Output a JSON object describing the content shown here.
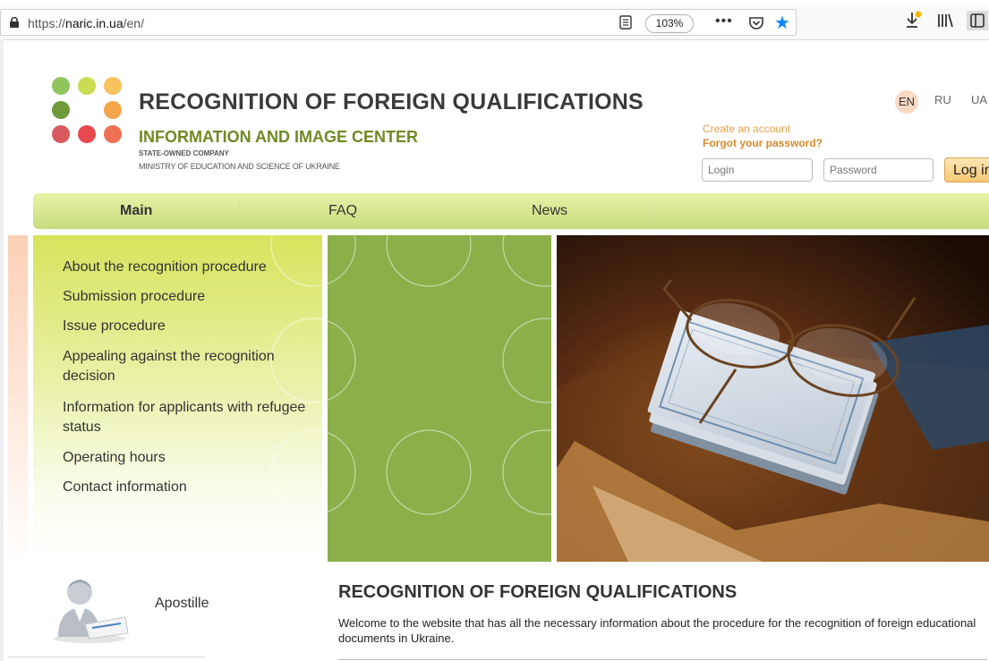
{
  "browser": {
    "url_prefix": "https://",
    "url_domain": "naric.in.ua",
    "url_path": "/en/",
    "zoom": "103%",
    "more_label": "•••",
    "bookmark_star": "★",
    "icons": [
      "lock-icon",
      "reader-view-icon",
      "pocket-icon",
      "bookmark-star-icon",
      "download-icon",
      "library-icon",
      "sidebar-icon"
    ]
  },
  "header": {
    "title": "RECOGNITION OF FOREIGN QUALIFICATIONS",
    "subtitle": "INFORMATION AND IMAGE CENTER",
    "company": "STATE-OWNED COMPANY",
    "ministry": "MINISTRY OF EDUCATION AND SCIENCE OF UKRAINE",
    "logo_colors": [
      "#8fc55e",
      "#c9dc52",
      "#f8c25c",
      "#6f9a3a",
      "#f4a54a",
      "#d9585e",
      "#e8494f",
      "#f07054"
    ]
  },
  "languages": {
    "en": "EN",
    "ru": "RU",
    "ua": "UA"
  },
  "auth": {
    "create_account": "Create an account",
    "forgot_password": "Forgot your password?",
    "login_placeholder": "Login",
    "password_placeholder": "Password",
    "login_button": "Log in"
  },
  "nav": {
    "main": "Main",
    "faq": "FAQ",
    "news": "News"
  },
  "sidebar_menu": [
    "About the recognition procedure",
    "Submission procedure",
    "Issue procedure",
    "Appealing against the recognition decision",
    "Information for applicants with refugee status",
    "Operating hours",
    "Contact information"
  ],
  "apostille": {
    "label": "Apostille"
  },
  "content": {
    "title": "RECOGNITION OF FOREIGN QUALIFICATIONS",
    "text": "Welcome to the website that has all the necessary information about the procedure for the recognition of foreign educational documents in Ukraine."
  }
}
